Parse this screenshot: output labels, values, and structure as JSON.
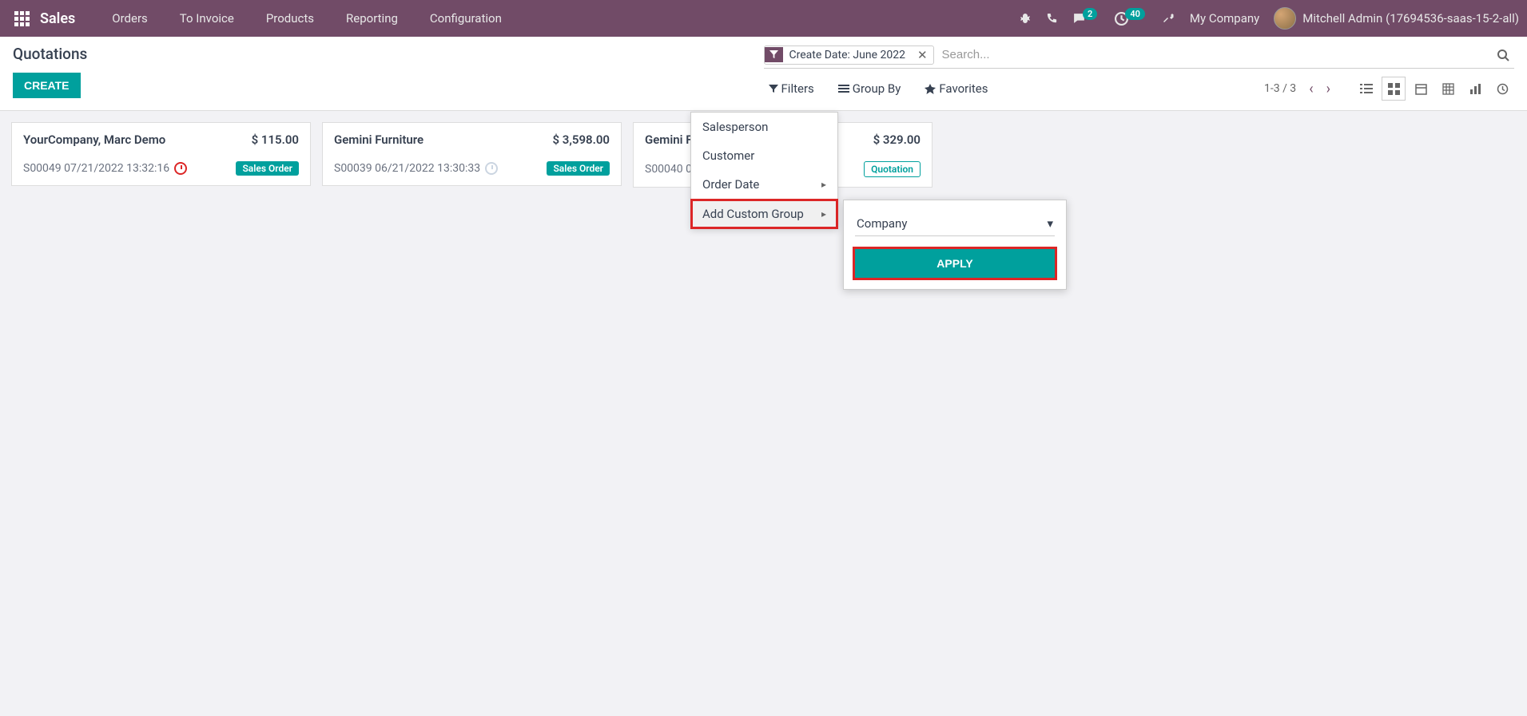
{
  "nav": {
    "brand": "Sales",
    "links": [
      "Orders",
      "To Invoice",
      "Products",
      "Reporting",
      "Configuration"
    ],
    "chat_badge": "2",
    "clock_badge": "40",
    "company": "My Company",
    "user": "Mitchell Admin (17694536-saas-15-2-all)"
  },
  "page": {
    "title": "Quotations",
    "create": "CREATE"
  },
  "search": {
    "facet_label": "Create Date: June 2022",
    "placeholder": "Search..."
  },
  "toolbar": {
    "filters": "Filters",
    "group_by": "Group By",
    "favorites": "Favorites",
    "pager": "1-3 / 3"
  },
  "groupby_menu": {
    "items": [
      "Salesperson",
      "Customer",
      "Order Date"
    ],
    "add_custom": "Add Custom Group"
  },
  "custom_group": {
    "field": "Company",
    "apply": "APPLY"
  },
  "cards": [
    {
      "title": "YourCompany, Marc Demo",
      "amount": "$ 115.00",
      "ref": "S00049 07/21/2022 13:32:16",
      "clock": "red",
      "status": "Sales Order",
      "status_style": "filled"
    },
    {
      "title": "Gemini Furniture",
      "amount": "$ 3,598.00",
      "ref": "S00039 06/21/2022 13:30:33",
      "clock": "grey",
      "status": "Sales Order",
      "status_style": "filled"
    },
    {
      "title": "Gemini F",
      "amount": "$ 329.00",
      "ref": "S00040 0",
      "clock": "none",
      "status": "Quotation",
      "status_style": "outlined"
    }
  ]
}
